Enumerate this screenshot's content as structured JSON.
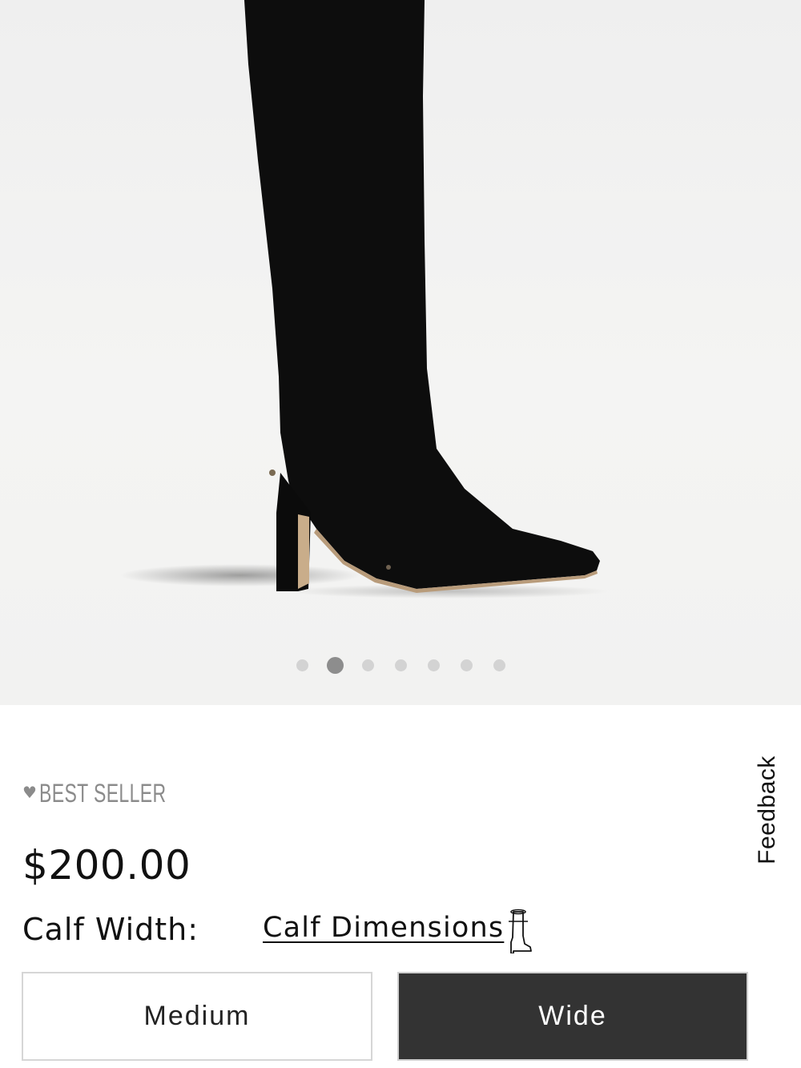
{
  "gallery": {
    "product_image": "black-suede-over-the-knee-boot",
    "slide_count": 7,
    "active_slide": 2,
    "dots": [
      "",
      "",
      "",
      "",
      "",
      "",
      ""
    ]
  },
  "badge": {
    "icon": "heart-icon",
    "text": "BEST SELLER",
    "color": "#8b8b8b"
  },
  "price": "$200.00",
  "calf": {
    "label": "Calf Width:",
    "link": "Calf Dimensions",
    "icon": "boot-icon"
  },
  "options": [
    {
      "label": "Medium",
      "selected": false
    },
    {
      "label": "Wide",
      "selected": true
    }
  ],
  "feedback": "Feedback",
  "colors": {
    "selected_bg": "#333333",
    "border": "#d6d6d6",
    "active_dot": "#8d8d8d",
    "dot": "#d3d3d3"
  }
}
